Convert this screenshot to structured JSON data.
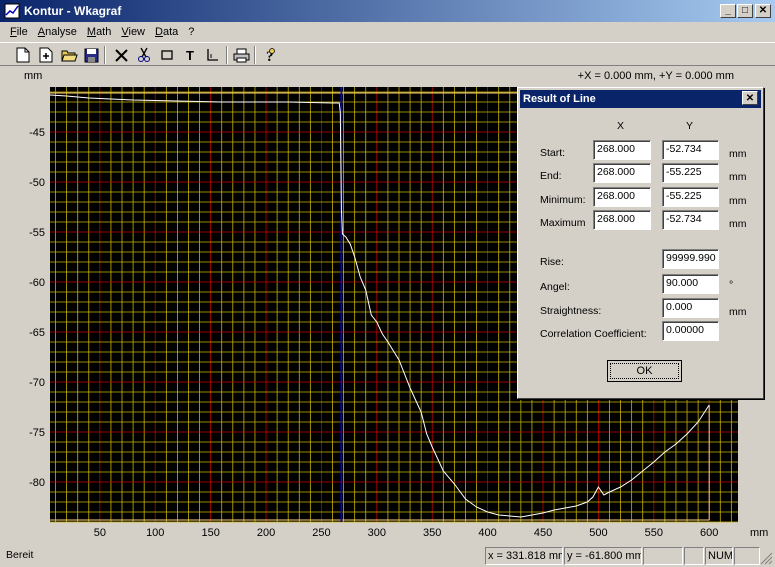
{
  "window": {
    "title": "Kontur - Wkagraf"
  },
  "menu": [
    "File",
    "Analyse",
    "Math",
    "View",
    "Data",
    "?"
  ],
  "toolbar_icons": [
    "new-file-icon",
    "new-doc-icon",
    "open-folder-icon",
    "save-icon",
    "cut-line-icon",
    "scissors-icon",
    "rectangle-icon",
    "text-tool-icon",
    "axes-icon",
    "print-icon",
    "help-icon"
  ],
  "chart": {
    "unit_y": "mm",
    "unit_x": "mm",
    "cursor_readout": "+X = 0.000 mm, +Y = 0.000 mm",
    "colors": {
      "background": "#000000",
      "grid_major": "#c00000",
      "grid_minor": "#c8b400",
      "profile": "#ffffff",
      "cursor_line": "#0000ff",
      "edge_line": "#ffd27f"
    }
  },
  "chart_data": {
    "type": "line",
    "title": "",
    "xlabel": "mm",
    "ylabel": "mm",
    "xlim": [
      5,
      626
    ],
    "ylim": [
      -84,
      -40.5
    ],
    "x_ticks": [
      50,
      100,
      150,
      200,
      250,
      300,
      350,
      400,
      450,
      500,
      550,
      600
    ],
    "y_ticks": [
      -45,
      -50,
      -55,
      -60,
      -65,
      -70,
      -75,
      -80
    ],
    "grid": true,
    "cursor_x": 268,
    "series": [
      {
        "x": [
          5,
          20,
          40,
          60,
          80,
          100,
          120,
          140,
          160,
          180,
          200,
          220,
          240,
          260,
          266,
          267,
          268,
          269,
          272,
          276,
          280,
          285,
          290,
          295,
          300,
          305,
          310,
          320,
          330,
          340,
          345,
          350,
          355,
          360,
          370,
          380,
          390,
          400,
          410,
          420,
          430,
          440,
          450,
          460,
          470,
          480,
          490,
          495,
          500,
          505,
          510,
          520,
          530,
          540,
          550,
          560,
          570,
          580,
          590,
          600
        ],
        "y": [
          -41.3,
          -41.4,
          -41.6,
          -41.7,
          -41.8,
          -41.85,
          -41.9,
          -41.95,
          -42.0,
          -42.0,
          -42.0,
          -42.0,
          -42.05,
          -42.1,
          -42.1,
          -43.0,
          -52.7,
          -55.2,
          -55.5,
          -56.2,
          -57.5,
          -59.5,
          -60.8,
          -63.3,
          -64.0,
          -65.2,
          -66.0,
          -67.8,
          -70.6,
          -73.0,
          -75.2,
          -76.5,
          -77.7,
          -78.9,
          -80.2,
          -81.7,
          -82.5,
          -83.0,
          -83.3,
          -83.4,
          -83.5,
          -83.3,
          -83.1,
          -82.8,
          -82.6,
          -82.4,
          -82.0,
          -81.5,
          -80.5,
          -81.3,
          -81.0,
          -80.5,
          -79.8,
          -78.9,
          -78.0,
          -77.0,
          -76.2,
          -75.2,
          -74.0,
          -72.3
        ]
      }
    ]
  },
  "dialog": {
    "title": "Result of Line",
    "col_x": "X",
    "col_y": "Y",
    "rows": [
      {
        "label": "Start:",
        "x": "268.000",
        "y": "-52.734",
        "unit": "mm"
      },
      {
        "label": "End:",
        "x": "268.000",
        "y": "-55.225",
        "unit": "mm"
      },
      {
        "label": "Minimum:",
        "x": "268.000",
        "y": "-55.225",
        "unit": "mm"
      },
      {
        "label": "Maximum",
        "x": "268.000",
        "y": "-52.734",
        "unit": "mm"
      }
    ],
    "rise": {
      "label": "Rise:",
      "value": "99999.990",
      "unit": ""
    },
    "angle": {
      "label": "Angel:",
      "value": "90.000",
      "unit": "°"
    },
    "straightness": {
      "label": "Straightness:",
      "value": "0.000",
      "unit": "mm"
    },
    "correlation": {
      "label": "Correlation Coefficient:",
      "value": "0.00000",
      "unit": ""
    },
    "ok_label": "OK"
  },
  "status": {
    "text": "Bereit",
    "x_readout": "x = 331.818 mm",
    "y_readout": "y = -61.800 mm",
    "num": "NUM"
  }
}
